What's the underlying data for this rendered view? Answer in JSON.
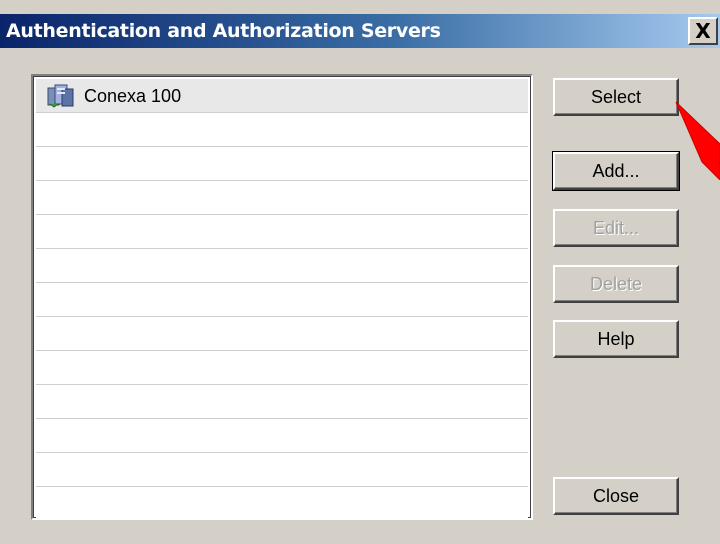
{
  "dialog": {
    "title": "Authentication and Authorization Servers",
    "close_glyph": "X"
  },
  "list": {
    "items": [
      {
        "label": "Conexa 100",
        "icon": "server-icon"
      },
      {
        "label": ""
      },
      {
        "label": ""
      },
      {
        "label": ""
      },
      {
        "label": ""
      },
      {
        "label": ""
      },
      {
        "label": ""
      },
      {
        "label": ""
      },
      {
        "label": ""
      },
      {
        "label": ""
      },
      {
        "label": ""
      },
      {
        "label": ""
      },
      {
        "label": ""
      }
    ]
  },
  "buttons": {
    "select": "Select",
    "add": "Add...",
    "edit": "Edit...",
    "delete": "Delete",
    "help": "Help",
    "close": "Close"
  },
  "colors": {
    "title_gradient_start": "#0a246a",
    "dialog_face": "#d4d0c8",
    "annotation_arrow": "#ff0000"
  }
}
